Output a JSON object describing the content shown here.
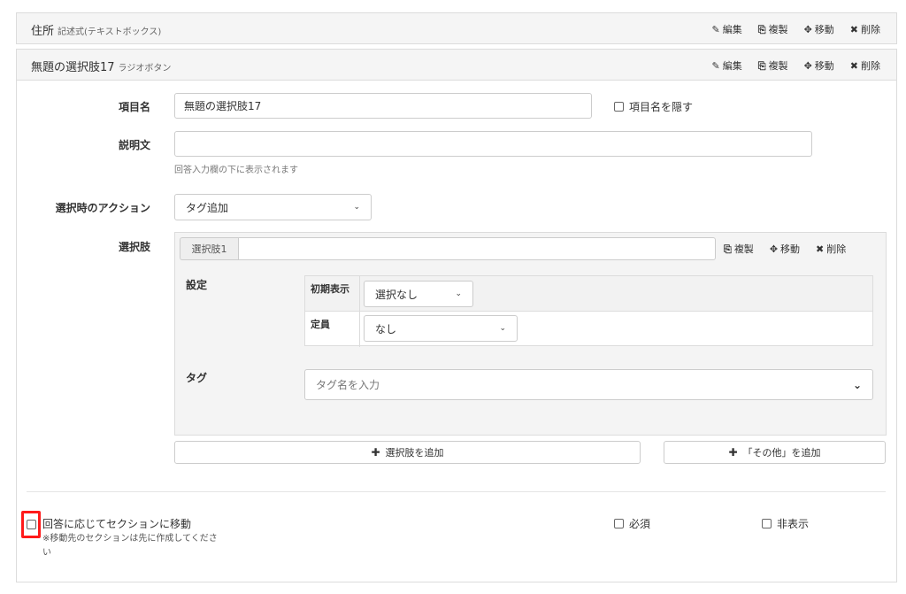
{
  "items": [
    {
      "title": "住所",
      "type_label": "記述式(テキストボックス)",
      "actions": {
        "edit": "編集",
        "duplicate": "複製",
        "move": "移動",
        "delete": "削除"
      }
    },
    {
      "title": "無題の選択肢17",
      "type_label": "ラジオボタン",
      "actions": {
        "edit": "編集",
        "duplicate": "複製",
        "move": "移動",
        "delete": "削除"
      }
    }
  ],
  "icons": {
    "edit": "✎",
    "duplicate": "⎘",
    "move": "✥",
    "delete": "✖",
    "caret": "⌄",
    "plus": "✚"
  },
  "form": {
    "item_name_label": "項目名",
    "item_name_value": "無題の選択肢17",
    "hide_name_label": "項目名を隠す",
    "description_label": "説明文",
    "description_value": "",
    "description_help": "回答入力欄の下に表示されます",
    "action_label": "選択時のアクション",
    "action_value": "タグ追加",
    "choices_label": "選択肢"
  },
  "choice": {
    "addon": "選択肢1",
    "value": "",
    "actions": {
      "duplicate": "複製",
      "move": "移動",
      "delete": "削除"
    },
    "settings_label": "設定",
    "initial_display_label": "初期表示",
    "initial_display_value": "選択なし",
    "capacity_label": "定員",
    "capacity_value": "なし",
    "tag_label": "タグ",
    "tag_placeholder": "タグ名を入力"
  },
  "buttons": {
    "add_choice": "選択肢を追加",
    "add_other": "「その他」を追加"
  },
  "footer": {
    "section_jump_label": "回答に応じてセクションに移動",
    "section_jump_note": "※移動先のセクションは先に作成してください",
    "required_label": "必須",
    "hidden_label": "非表示"
  },
  "colors": {
    "highlight": "#ff1a1a",
    "panel_bg": "#f5f5f5",
    "border": "#dcdcdc"
  }
}
